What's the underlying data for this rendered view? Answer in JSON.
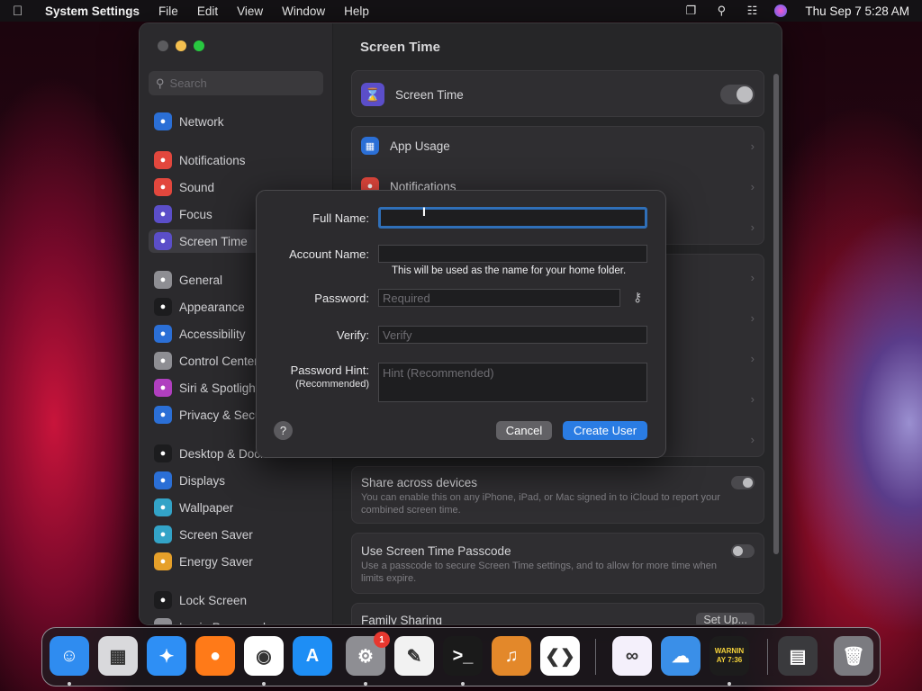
{
  "menubar": {
    "app_name": "System Settings",
    "items": [
      "File",
      "Edit",
      "View",
      "Window",
      "Help"
    ],
    "clock": "Thu Sep 7  5:28 AM"
  },
  "search": {
    "placeholder": "Search"
  },
  "sidebar": {
    "items": [
      {
        "label": "Network",
        "icon": "globe-icon",
        "color": "#2b6fd6"
      },
      {
        "label": "Notifications",
        "icon": "bell-icon",
        "color": "#e2473d"
      },
      {
        "label": "Sound",
        "icon": "speaker-icon",
        "color": "#e2473d"
      },
      {
        "label": "Focus",
        "icon": "moon-icon",
        "color": "#5b4ec9"
      },
      {
        "label": "Screen Time",
        "icon": "hourglass-icon",
        "color": "#5b4ec9"
      },
      {
        "label": "General",
        "icon": "gear-icon",
        "color": "#8e8e93"
      },
      {
        "label": "Appearance",
        "icon": "appearance-icon",
        "color": "#1c1c1e"
      },
      {
        "label": "Accessibility",
        "icon": "accessibility-icon",
        "color": "#2b6fd6"
      },
      {
        "label": "Control Center",
        "icon": "control-center-icon",
        "color": "#8e8e93"
      },
      {
        "label": "Siri & Spotlight",
        "icon": "siri-icon",
        "color": "#b03fbf"
      },
      {
        "label": "Privacy & Security",
        "icon": "hand-icon",
        "color": "#2b6fd6"
      },
      {
        "label": "Desktop & Dock",
        "icon": "dock-icon",
        "color": "#1c1c1e"
      },
      {
        "label": "Displays",
        "icon": "sun-icon",
        "color": "#2b6fd6"
      },
      {
        "label": "Wallpaper",
        "icon": "wallpaper-icon",
        "color": "#33a3c7"
      },
      {
        "label": "Screen Saver",
        "icon": "screensaver-icon",
        "color": "#33a3c7"
      },
      {
        "label": "Energy Saver",
        "icon": "battery-icon",
        "color": "#e6a02a"
      },
      {
        "label": "Lock Screen",
        "icon": "lock-icon",
        "color": "#1c1c1e"
      },
      {
        "label": "Login Password",
        "icon": "password-icon",
        "color": "#8e8e93"
      }
    ]
  },
  "content": {
    "title": "Screen Time",
    "screen_time_label": "Screen Time",
    "app_usage_label": "App Usage",
    "notifications_label": "Notifications",
    "share_title": "Share across devices",
    "share_sub": "You can enable this on any iPhone, iPad, or Mac signed in to iCloud to report your combined screen time.",
    "passcode_title": "Use Screen Time Passcode",
    "passcode_sub": "Use a passcode to secure Screen Time settings, and to allow for more time when limits expire.",
    "family_title": "Family Sharing",
    "family_button": "Set Up..."
  },
  "sheet": {
    "full_name_label": "Full Name:",
    "full_name_value": "",
    "account_name_label": "Account Name:",
    "account_name_value": "",
    "account_hint": "This will be used as the name for your home folder.",
    "password_label": "Password:",
    "password_placeholder": "Required",
    "verify_label": "Verify:",
    "verify_placeholder": "Verify",
    "hint_label": "Password Hint:",
    "hint_sublabel": "(Recommended)",
    "hint_placeholder": "Hint (Recommended)",
    "help": "?",
    "cancel": "Cancel",
    "create": "Create User"
  },
  "dock": {
    "apps": [
      {
        "name": "finder-icon",
        "glyph": "☺",
        "color": "#2f8cf0",
        "running": true
      },
      {
        "name": "launchpad-icon",
        "glyph": "▦",
        "color": "#d9d9dc",
        "running": false
      },
      {
        "name": "safari-icon",
        "glyph": "✦",
        "color": "#2e8ff5",
        "running": false
      },
      {
        "name": "firefox-icon",
        "glyph": "●",
        "color": "#ff7a18",
        "running": false
      },
      {
        "name": "chrome-icon",
        "glyph": "◉",
        "color": "#ffffff",
        "running": true
      },
      {
        "name": "app-store-icon",
        "glyph": "A",
        "color": "#1e8ef5",
        "running": false
      },
      {
        "name": "system-settings-icon",
        "glyph": "⚙",
        "color": "#8e8e93",
        "running": true,
        "badge": "1"
      },
      {
        "name": "textedit-icon",
        "glyph": "✎",
        "color": "#f2f2f2",
        "running": false
      },
      {
        "name": "terminal-icon",
        "glyph": ">_",
        "color": "#1a1a1a",
        "running": true
      },
      {
        "name": "garageband-icon",
        "glyph": "♫",
        "color": "#e3882a",
        "running": false
      },
      {
        "name": "vscode-icon",
        "glyph": "❮❯",
        "color": "#ffffff",
        "running": false
      },
      {
        "name": "visual-studio-icon",
        "glyph": "∞",
        "color": "#f4f0fb",
        "running": false
      },
      {
        "name": "weather-icon",
        "glyph": "☁",
        "color": "#3a8fe8",
        "running": false
      },
      {
        "name": "console-icon",
        "glyph": "WARNIN AY 7:36",
        "color": "#1c1c1c",
        "running": true
      },
      {
        "name": "downloads-stack-icon",
        "glyph": "▤",
        "color": "#3a3a3d",
        "running": false
      },
      {
        "name": "trash-icon",
        "glyph": "🗑",
        "color": "#7b7b80",
        "running": false
      }
    ]
  }
}
